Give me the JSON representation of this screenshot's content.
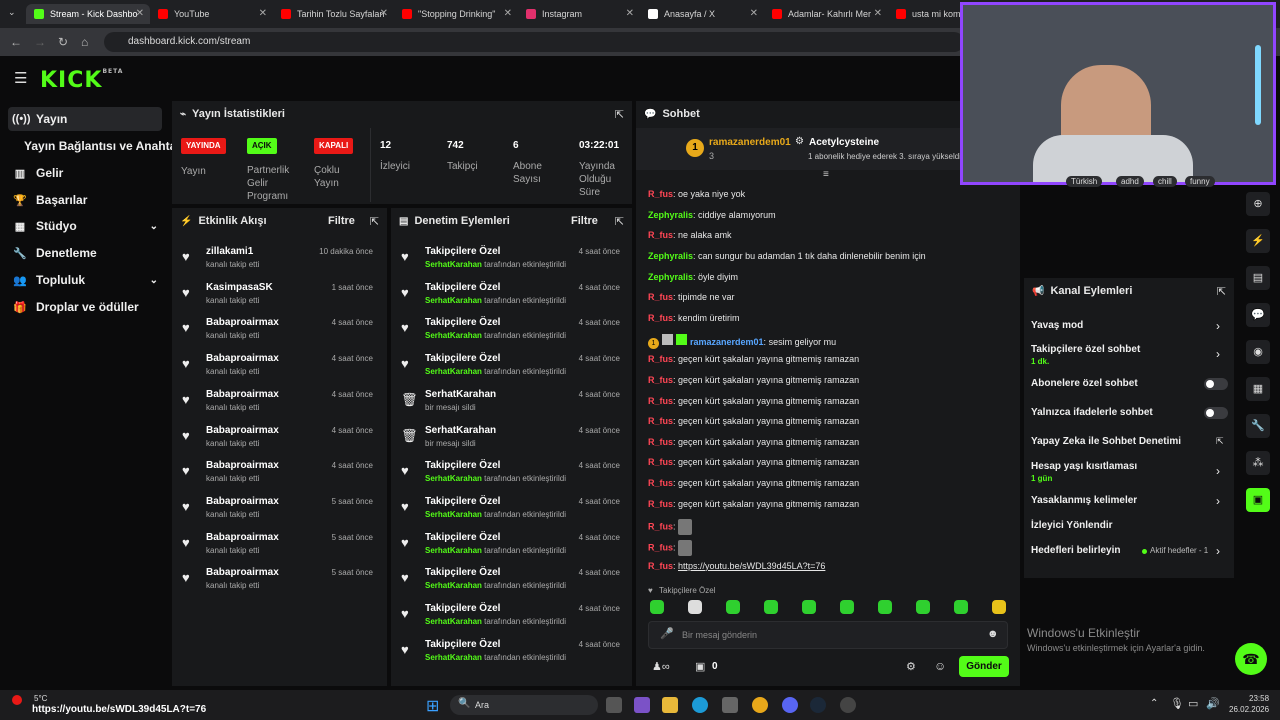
{
  "browser": {
    "tabs": [
      {
        "label": "Stream - Kick Dashbo",
        "color": "#53fc18",
        "active": true
      },
      {
        "label": "YouTube",
        "color": "#ff0000"
      },
      {
        "label": "Tarihin Tozlu Sayfaları",
        "color": "#ff0000"
      },
      {
        "label": "\"Stopping Drinking\"",
        "color": "#ff0000"
      },
      {
        "label": "Instagram",
        "color": "#e1306c"
      },
      {
        "label": "Anasayfa / X",
        "color": "#ffffff"
      },
      {
        "label": "Adamlar- Kahırlı Mer",
        "color": "#ff0000"
      },
      {
        "label": "usta mi komedy",
        "color": "#ff0000"
      }
    ],
    "url": "dashboard.kick.com/stream"
  },
  "brand": {
    "logo": "KICK",
    "beta": "BETA",
    "accent": "#53fc18"
  },
  "nav": [
    {
      "label": "Yayın",
      "icon": "stream-icon",
      "glyph": "((•))"
    },
    {
      "label": "Yayın Bağlantısı ve Anahtarı",
      "icon": "",
      "glyph": ""
    },
    {
      "label": "Gelir",
      "icon": "chart-icon",
      "glyph": "▥"
    },
    {
      "label": "Başarılar",
      "icon": "trophy-icon",
      "glyph": "🏆"
    },
    {
      "label": "Stüdyo",
      "icon": "studio-icon",
      "glyph": "▦"
    },
    {
      "label": "Denetleme",
      "icon": "wrench-icon",
      "glyph": "🔧"
    },
    {
      "label": "Topluluk",
      "icon": "people-icon",
      "glyph": "👥"
    },
    {
      "label": "Droplar ve ödüller",
      "icon": "gift-icon",
      "glyph": "🎁"
    }
  ],
  "stats": {
    "title": "Yayın İstatistikleri",
    "yayin_badge": "YAYINDA",
    "yayin_label": "Yayın",
    "partner_badge": "AÇIK",
    "partner_label": "Partnerlik Gelir Programı",
    "multi_badge": "KAPALI",
    "multi_label": "Çoklu Yayın",
    "viewers": "12",
    "viewers_label": "İzleyici",
    "followers": "742",
    "followers_label": "Takipçi",
    "subs": "6",
    "subs_label": "Abone Sayısı",
    "uptime": "03:22:01",
    "uptime_label": "Yayında Olduğu Süre"
  },
  "activity": {
    "title": "Etkinlik Akışı",
    "filter": "Filtre",
    "items": [
      {
        "name": "zillakami1",
        "sub": "kanalı takip etti",
        "time": "10 dakika önce"
      },
      {
        "name": "KasimpasaSK",
        "sub": "kanalı takip etti",
        "time": "1 saat önce"
      },
      {
        "name": "Babaproairmax",
        "sub": "kanalı takip etti",
        "time": "4 saat önce"
      },
      {
        "name": "Babaproairmax",
        "sub": "kanalı takip etti",
        "time": "4 saat önce"
      },
      {
        "name": "Babaproairmax",
        "sub": "kanalı takip etti",
        "time": "4 saat önce"
      },
      {
        "name": "Babaproairmax",
        "sub": "kanalı takip etti",
        "time": "4 saat önce"
      },
      {
        "name": "Babaproairmax",
        "sub": "kanalı takip etti",
        "time": "4 saat önce"
      },
      {
        "name": "Babaproairmax",
        "sub": "kanalı takip etti",
        "time": "5 saat önce"
      },
      {
        "name": "Babaproairmax",
        "sub": "kanalı takip etti",
        "time": "5 saat önce"
      },
      {
        "name": "Babaproairmax",
        "sub": "kanalı takip etti",
        "time": "5 saat önce"
      }
    ]
  },
  "moderation": {
    "title": "Denetim Eylemleri",
    "filter": "Filtre",
    "items": [
      {
        "name": "Takipçilere Özel",
        "user": "SerhatKarahan",
        "rest": " tarafından etkinleştirildi",
        "time": "4 saat önce",
        "icon": "heart-icon"
      },
      {
        "name": "Takipçilere Özel",
        "user": "SerhatKarahan",
        "rest": " tarafından etkinleştirildi",
        "time": "4 saat önce",
        "icon": "heart-icon"
      },
      {
        "name": "Takipçilere Özel",
        "user": "SerhatKarahan",
        "rest": " tarafından etkinleştirildi",
        "time": "4 saat önce",
        "icon": "heart-icon"
      },
      {
        "name": "Takipçilere Özel",
        "user": "SerhatKarahan",
        "rest": " tarafından etkinleştirildi",
        "time": "4 saat önce",
        "icon": "heart-icon"
      },
      {
        "name": "SerhatKarahan",
        "user": "",
        "rest": "bir mesajı sildi",
        "time": "4 saat önce",
        "icon": "trash-icon"
      },
      {
        "name": "SerhatKarahan",
        "user": "",
        "rest": "bir mesajı sildi",
        "time": "4 saat önce",
        "icon": "trash-icon"
      },
      {
        "name": "Takipçilere Özel",
        "user": "SerhatKarahan",
        "rest": " tarafından etkinleştirildi",
        "time": "4 saat önce",
        "icon": "heart-icon"
      },
      {
        "name": "Takipçilere Özel",
        "user": "SerhatKarahan",
        "rest": " tarafından etkinleştirildi",
        "time": "4 saat önce",
        "icon": "heart-icon"
      },
      {
        "name": "Takipçilere Özel",
        "user": "SerhatKarahan",
        "rest": " tarafından etkinleştirildi",
        "time": "4 saat önce",
        "icon": "heart-icon"
      },
      {
        "name": "Takipçilere Özel",
        "user": "SerhatKarahan",
        "rest": " tarafından etkinleştirildi",
        "time": "4 saat önce",
        "icon": "heart-icon"
      },
      {
        "name": "Takipçilere Özel",
        "user": "SerhatKarahan",
        "rest": " tarafından etkinleştirildi",
        "time": "4 saat önce",
        "icon": "heart-icon"
      },
      {
        "name": "Takipçilere Özel",
        "user": "SerhatKarahan",
        "rest": " tarafından etkinleştirildi",
        "time": "4 saat önce",
        "icon": "heart-icon"
      }
    ]
  },
  "chat": {
    "title": "Sohbet",
    "pinned_user": "ramazanerdem01",
    "pinned_level": "3",
    "pinned_gift_user": "Acetylcysteine",
    "pinned_gift_text": "1 abonelik hediye ederek 3. sıraya yükseldi",
    "messages": [
      {
        "user": "R_fus",
        "cls": "u",
        "text": "oe yaka niye yok"
      },
      {
        "user": "Zephyralis",
        "cls": "z",
        "text": "ciddiye alamıyorum"
      },
      {
        "user": "R_fus",
        "cls": "u",
        "text": "ne alaka amk"
      },
      {
        "user": "Zephyralis",
        "cls": "z",
        "text": "can sungur bu adamdan 1 tık daha dinlenebilir benim için"
      },
      {
        "user": "Zephyralis",
        "cls": "z",
        "text": "öyle diyim"
      },
      {
        "user": "R_fus",
        "cls": "u",
        "text": "tipimde ne var"
      },
      {
        "user": "R_fus",
        "cls": "u",
        "text": "kendim üretirim"
      },
      {
        "user": "ramazanerdem01",
        "cls": "b",
        "text": "sesim geliyor mu"
      },
      {
        "user": "R_fus",
        "cls": "u",
        "text": "geçen kürt şakaları yayına gitmemiş ramazan"
      },
      {
        "user": "R_fus",
        "cls": "u",
        "text": "geçen kürt şakaları yayına gitmemiş ramazan"
      },
      {
        "user": "R_fus",
        "cls": "u",
        "text": "geçen kürt şakaları yayına gitmemiş ramazan"
      },
      {
        "user": "R_fus",
        "cls": "u",
        "text": "geçen kürt şakaları yayına gitmemiş ramazan"
      },
      {
        "user": "R_fus",
        "cls": "u",
        "text": "geçen kürt şakaları yayına gitmemiş ramazan"
      },
      {
        "user": "R_fus",
        "cls": "u",
        "text": "geçen kürt şakaları yayına gitmemiş ramazan"
      },
      {
        "user": "R_fus",
        "cls": "u",
        "text": "geçen kürt şakaları yayına gitmemiş ramazan"
      },
      {
        "user": "R_fus",
        "cls": "u",
        "text": "geçen kürt şakaları yayına gitmemiş ramazan"
      },
      {
        "user": "R_fus",
        "cls": "u",
        "text": ""
      },
      {
        "user": "R_fus",
        "cls": "u",
        "text": ""
      },
      {
        "user": "R_fus",
        "cls": "u",
        "text": "https://youtu.be/sWDL39d45LA?t=76"
      }
    ],
    "followers_only": "Takipçilere Özel",
    "input_placeholder": "Bir mesaj gönderin",
    "points": "0",
    "send": "Gönder"
  },
  "tags": [
    "Türkish",
    "adhd",
    "chill",
    "funny"
  ],
  "channel_actions": {
    "title": "Kanal Eylemleri",
    "items": [
      {
        "label": "Yavaş mod",
        "sub": "",
        "control": "arrow"
      },
      {
        "label": "Takipçilere özel sohbet",
        "sub": "1 dk.",
        "control": "arrow"
      },
      {
        "label": "Abonelere özel sohbet",
        "sub": "",
        "control": "toggle"
      },
      {
        "label": "Yalnızca ifadelerle sohbet",
        "sub": "",
        "control": "toggle"
      },
      {
        "label": "Yapay Zeka ile Sohbet Denetimi",
        "sub": "",
        "control": "external"
      },
      {
        "label": "Hesap yaşı kısıtlaması",
        "sub": "1 gün",
        "control": "arrow"
      },
      {
        "label": "Yasaklanmış kelimeler",
        "sub": "",
        "control": "arrow"
      },
      {
        "label": "İzleyici Yönlendir",
        "sub": "",
        "control": "none"
      },
      {
        "label": "Hedefleri belirleyin",
        "sub": "",
        "control": "arrow"
      }
    ],
    "goal_status": "Aktif hedefler - 1"
  },
  "watermark": {
    "title": "Windows'u Etkinleştir",
    "sub": "Windows'u etkinleştirmek için Ayarlar'a gidin."
  },
  "taskbar": {
    "temp": "5°C",
    "link_tooltip": "https://youtu.be/sWDL39d45LA?t=76",
    "search": "Ara",
    "time": "23:58",
    "date": "26.02.2026"
  }
}
